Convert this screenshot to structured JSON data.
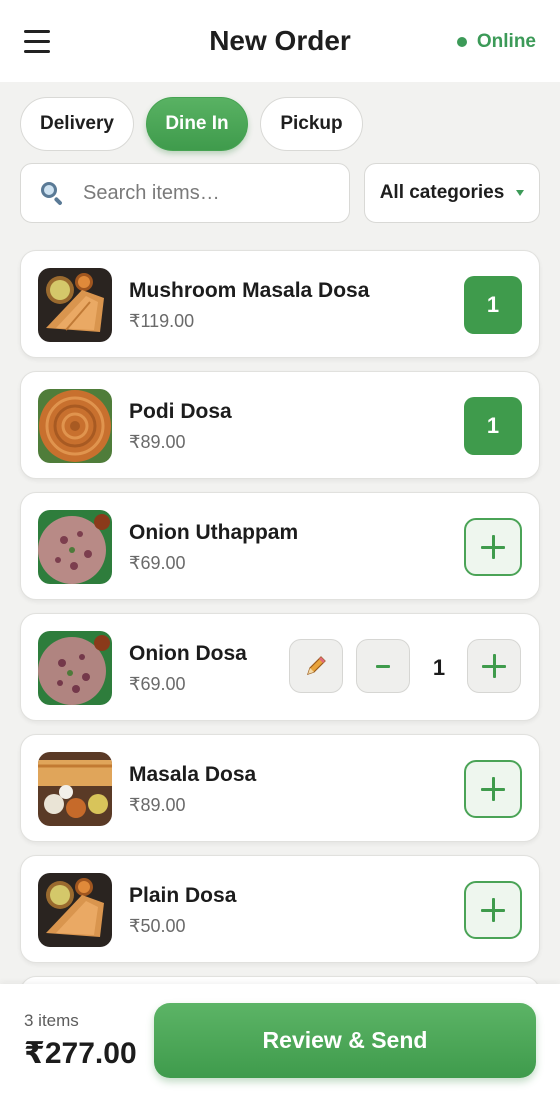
{
  "header": {
    "title": "New Order",
    "status": "Online",
    "menu_icon": "hamburger-menu-icon"
  },
  "order_types": {
    "delivery": "Delivery",
    "dine_in": "Dine In",
    "pickup": "Pickup",
    "selected": "Dine In"
  },
  "search": {
    "placeholder": "Search items…",
    "category": "All categories"
  },
  "items": [
    {
      "name": "Mushroom Masala Dosa",
      "price": "₹119.00",
      "qty": "1"
    },
    {
      "name": "Podi Dosa",
      "price": "₹89.00",
      "qty": "1"
    },
    {
      "name": "Onion Uthappam",
      "price": "₹69.00"
    },
    {
      "name": "Onion Dosa",
      "price": "₹69.00",
      "qty": "1"
    },
    {
      "name": "Masala Dosa",
      "price": "₹89.00"
    },
    {
      "name": "Plain Dosa",
      "price": "₹50.00"
    }
  ],
  "footer": {
    "count": "3 items",
    "total": "₹277.00",
    "review": "Review & Send"
  },
  "colors": {
    "accent": "#3f9b4c",
    "status": "#3c9a58"
  }
}
